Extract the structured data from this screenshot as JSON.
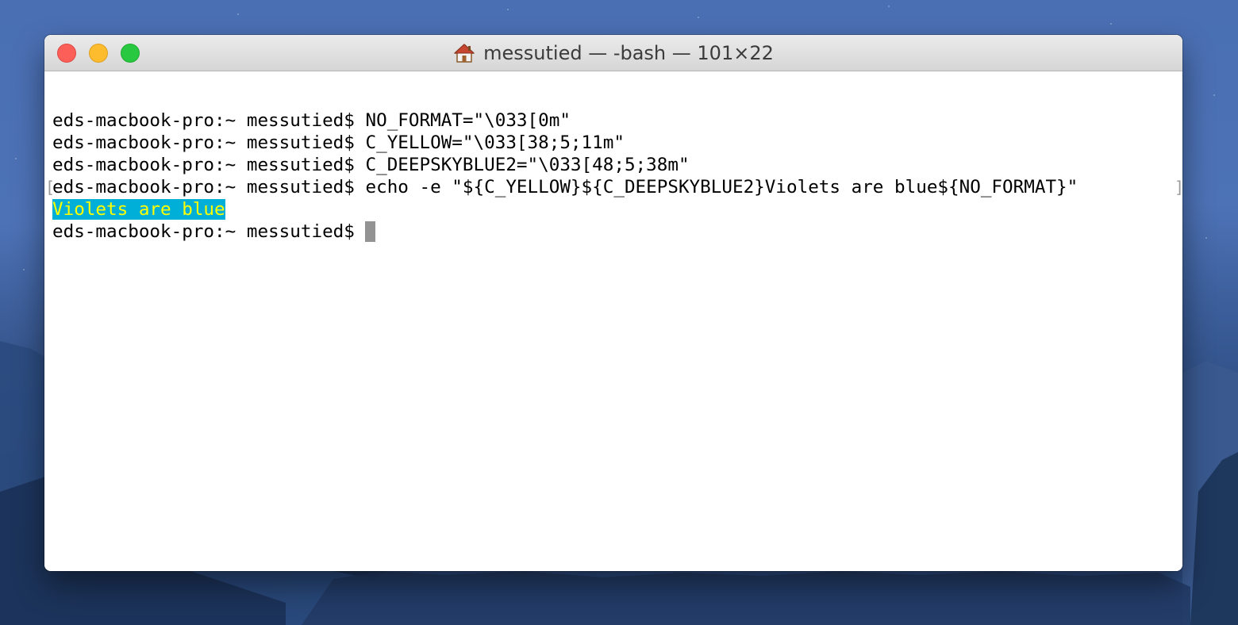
{
  "window": {
    "title": "messutied — -bash — 101×22",
    "icon": "home-icon"
  },
  "terminal": {
    "lines": [
      {
        "prompt": "eds-macbook-pro:~ messutied$ ",
        "command": "NO_FORMAT=\"\\033[0m\""
      },
      {
        "prompt": "eds-macbook-pro:~ messutied$ ",
        "command": "C_YELLOW=\"\\033[38;5;11m\""
      },
      {
        "prompt": "eds-macbook-pro:~ messutied$ ",
        "command": "C_DEEPSKYBLUE2=\"\\033[48;5;38m\""
      },
      {
        "prompt": "eds-macbook-pro:~ messutied$ ",
        "command": "echo -e \"${C_YELLOW}${C_DEEPSKYBLUE2}Violets are blue${NO_FORMAT}\""
      }
    ],
    "output": "Violets are blue",
    "current_prompt": "eds-macbook-pro:~ messutied$ "
  },
  "colors": {
    "output_background": "#00afd7",
    "output_foreground": "#ffff00",
    "close": "#fc5f57",
    "minimize": "#fdbc2e",
    "zoom": "#28c940"
  }
}
